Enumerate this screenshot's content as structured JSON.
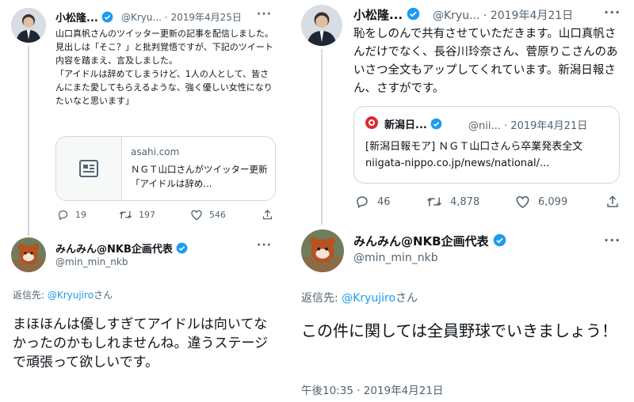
{
  "left": {
    "tweet": {
      "author_name": "小松隆...",
      "handle": "@Kryu...",
      "separator": "·",
      "date": "2019年4月25日",
      "text": "山口真帆さんのツイッター更新の記事を配信しました。見出しは「そこ？」と批判覚悟ですが、下記のツイート内容を踏まえ、言及しました。\n「アイドルは辞めてしまうけど、1人の人として、皆さんにまた愛してもらえるような、強く優しい女性になりたいなと思います」",
      "card": {
        "domain": "asahi.com",
        "title": "ＮＧＴ山口さんがツイッター更新　「アイドルは辞め..."
      },
      "replies": "19",
      "retweets": "197",
      "likes": "546"
    },
    "reply": {
      "author_name": "みんみん@NKB企画代表",
      "handle": "@min_min_nkb",
      "replying_to_prefix": "返信先: ",
      "replying_to_user": "@Kryujiro",
      "replying_to_suffix": "さん",
      "text": "まほほんは優しすぎてアイドルは向いてなかったのかもしれませんね。違うステージで頑張って欲しいです。"
    }
  },
  "right": {
    "tweet": {
      "author_name": "小松隆...",
      "handle": "@Kryu...",
      "separator": "·",
      "date": "2019年4月21日",
      "text": "恥をしのんで共有させていただきます。山口真帆さんだけでなく、長谷川玲奈さん、菅原りこさんのあいさつ全文もアップしてくれています。新潟日報さん、さすがです。",
      "quote": {
        "name": "新潟日...",
        "handle": "@nii...",
        "separator": "·",
        "date": "2019年4月21日",
        "text": "[新潟日報モア] ＮＧＴ山口さんら卒業発表全文 niigata-nippo.co.jp/news/national/..."
      },
      "replies": "46",
      "retweets": "4,878",
      "likes": "6,099"
    },
    "reply": {
      "author_name": "みんみん@NKB企画代表",
      "handle": "@min_min_nkb",
      "replying_to_prefix": "返信先: ",
      "replying_to_user": "@Kryujiro",
      "replying_to_suffix": "さん",
      "text": "この件に関しては全員野球でいきましょう！",
      "timestamp": "午後10:35 · 2019年4月21日"
    }
  },
  "colors": {
    "verified": "#1d9bf0",
    "text": "#0f1419",
    "secondary": "#536471",
    "link": "#1d9bf0",
    "border": "#cfd9de",
    "newspaper_brand": "#e0282f"
  },
  "icons": {
    "verified": "verified-badge-icon",
    "reply": "reply-icon",
    "retweet": "retweet-icon",
    "like": "heart-icon",
    "share": "share-icon",
    "more": "more-dots-icon",
    "article": "article-icon"
  }
}
